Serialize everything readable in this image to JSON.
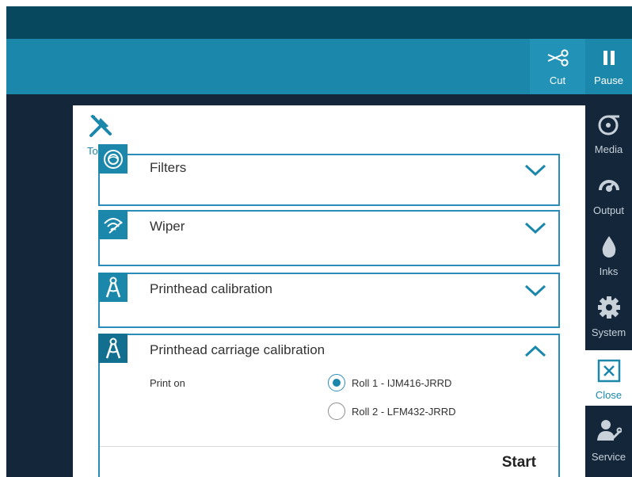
{
  "toolbar": {
    "cut": {
      "label": "Cut",
      "icon": "scissors-icon"
    },
    "pause": {
      "label": "Pause",
      "icon": "pause-icon"
    }
  },
  "tools": {
    "label": "Tools",
    "icon": "wrench-screwdriver-icon"
  },
  "sections": [
    {
      "title": "Filters",
      "icon": "filter-icon",
      "expanded": false
    },
    {
      "title": "Wiper",
      "icon": "wiper-icon",
      "expanded": false
    },
    {
      "title": "Printhead calibration",
      "icon": "calibration-compass-icon",
      "expanded": false
    },
    {
      "title": "Printhead carriage calibration",
      "icon": "calibration-compass-icon",
      "expanded": true
    }
  ],
  "calibration": {
    "print_on_label": "Print on",
    "options": [
      {
        "label": "Roll 1 - IJM416-JRRD",
        "selected": true
      },
      {
        "label": "Roll 2 - LFM432-JRRD",
        "selected": false
      }
    ],
    "start_label": "Start"
  },
  "sidebar": {
    "items": [
      {
        "label": "Media",
        "icon": "media-roll-icon"
      },
      {
        "label": "Output",
        "icon": "output-gauge-icon"
      },
      {
        "label": "Inks",
        "icon": "ink-drop-icon"
      },
      {
        "label": "System",
        "icon": "gear-icon"
      },
      {
        "label": "Close",
        "icon": "close-icon",
        "active": true
      },
      {
        "label": "Service",
        "icon": "service-person-icon"
      }
    ]
  },
  "colors": {
    "accent": "#1a87ab",
    "dark_navy": "#13263a",
    "title_bar": "#07485f",
    "toolbar": "#1a87ab"
  }
}
